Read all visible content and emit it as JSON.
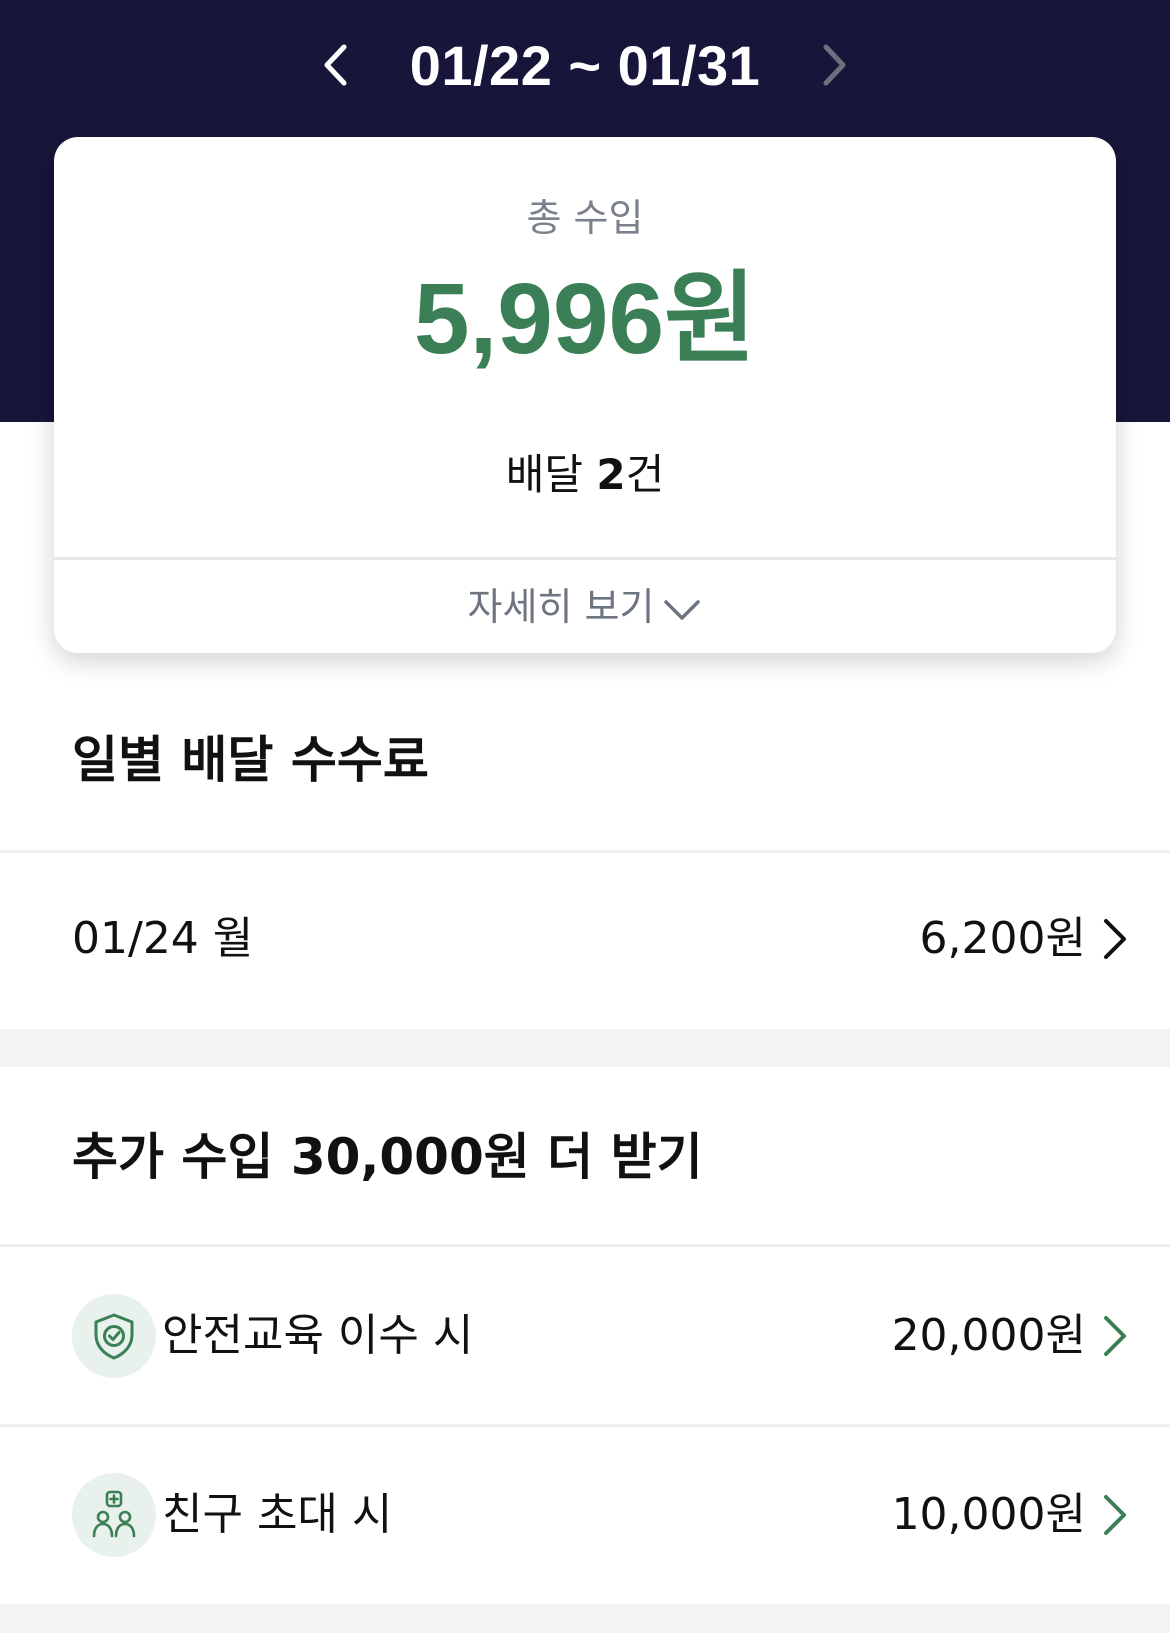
{
  "header": {
    "date_range": "01/22 ~ 01/31"
  },
  "summary": {
    "label": "총 수입",
    "amount": "5,996원",
    "delivery_prefix": "배달 ",
    "delivery_count": "2",
    "delivery_suffix": "건",
    "more_label": "자세히 보기"
  },
  "daily": {
    "title": "일별 배달 수수료",
    "items": [
      {
        "date": "01/24 월",
        "amount": "6,200원"
      }
    ]
  },
  "extra": {
    "title": "추가 수입 30,000원 더 받기",
    "items": [
      {
        "icon": "shield-check-icon",
        "label": "안전교육 이수 시",
        "amount": "20,000원"
      },
      {
        "icon": "invite-friends-icon",
        "label": "친구 초대 시",
        "amount": "10,000원"
      }
    ]
  },
  "colors": {
    "header_bg": "#17163a",
    "accent_green": "#3a7f55",
    "icon_bg": "#e8f1ec"
  }
}
